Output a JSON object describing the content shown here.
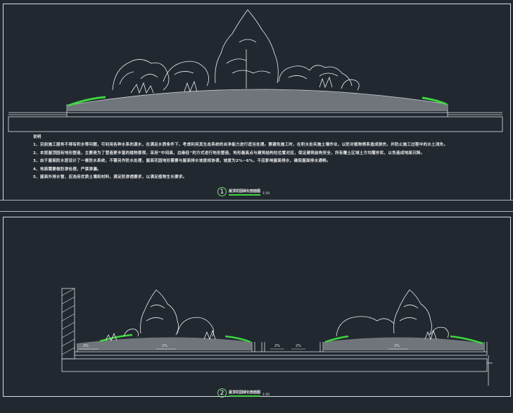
{
  "notes": {
    "heading": "说明",
    "items": [
      "1、目前施工服务不得有积水等问题，可利用各种水系的源水，在满足水质条件下，考虑利用其生态系统的自净能力进行适当处理。要避免施工时，在积水处实施土壤作业，以防对植物根系造成损伤，并防止施工过程中的水土流失。",
      "2、本层屋顶园有地形塑造，主要是为了营造更丰富的植物景观，采用“中间高，边缘低”的方式进行地形塑造，地形最高点与建筑结构柱位置对应，保证建筑结构安全，所有覆土区域土方均需夯实，以免造成地面沉降。",
      "3、由于屋面防水层设计了一套防水系统，不需另作防水处理，屋面花园地形需要与屋面排水坡度相协调，坡度为2%~6%，不应影响屋面排水，确保屋面排水通畅。",
      "4、地面需要做防渗处理，严禁渗漏。",
      "5、屋面外排水管，应选用优质土壤和材料，满足防渗透要求，以满足植物生长要求。"
    ]
  },
  "section1": {
    "number": "1",
    "title": "屋顶花园绿化剖面图",
    "scale": "1:50"
  },
  "section2": {
    "number": "2",
    "title": "屋顶花园绿化剖面图",
    "scale": "1:50"
  },
  "dims": {
    "d1": "2%",
    "d2": "2%",
    "d3": "2%",
    "d4": "2%",
    "d5": "2%"
  },
  "colors": {
    "background": "#212830",
    "lines": "#dde2e6",
    "grass": "#3fd63f",
    "soil": "#8a8f94"
  }
}
